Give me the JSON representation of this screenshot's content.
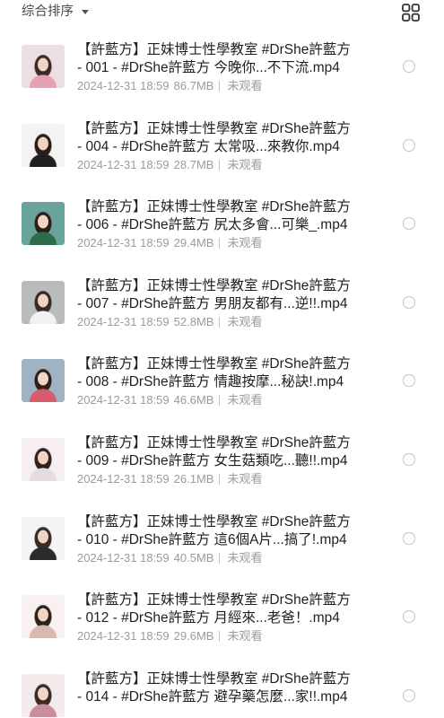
{
  "header": {
    "sort_label": "综合排序",
    "sort_icon": "caret-down-icon",
    "view_icon": "grid-view-icon"
  },
  "files": [
    {
      "title_lines": [
        "【許藍方】正妹博士性學教室 #DrShe許藍方",
        "- 001 - #DrShe許藍方 今晚你...不下流.mp4"
      ],
      "date": "2024-12-31 18:59",
      "size": "86.7MB",
      "status": "未观看",
      "thumb": {
        "bg": "#ecdfe4",
        "hair": "#3b2a25",
        "top": "#e6a0b3"
      }
    },
    {
      "title_lines": [
        "【許藍方】正妹博士性學教室 #DrShe許藍方",
        "- 004 - #DrShe許藍方 太常吸...來教你.mp4"
      ],
      "date": "2024-12-31 18:59",
      "size": "28.7MB",
      "status": "未观看",
      "thumb": {
        "bg": "#f3f3f1",
        "hair": "#2a1d18",
        "top": "#1f1f22"
      }
    },
    {
      "title_lines": [
        "【許藍方】正妹博士性學教室 #DrShe許藍方",
        "- 006 - #DrShe許藍方 尻太多會...可樂_.mp4"
      ],
      "date": "2024-12-31 18:59",
      "size": "29.4MB",
      "status": "未观看",
      "thumb": {
        "bg": "#6aa39a",
        "hair": "#2b1f1a",
        "top": "#2f6a4a"
      }
    },
    {
      "title_lines": [
        "【許藍方】正妹博士性學教室 #DrShe許藍方",
        "- 007 - #DrShe許藍方 男朋友都有...逆!!.mp4"
      ],
      "date": "2024-12-31 18:59",
      "size": "52.8MB",
      "status": "未观看",
      "thumb": {
        "bg": "#b9bcbf",
        "hair": "#3a2a22",
        "top": "#f1f1f1"
      }
    },
    {
      "title_lines": [
        "【許藍方】正妹博士性學教室 #DrShe許藍方",
        "- 008 - #DrShe許藍方 情趣按摩...秘訣!.mp4"
      ],
      "date": "2024-12-31 18:59",
      "size": "46.6MB",
      "status": "未观看",
      "thumb": {
        "bg": "#9fb3c4",
        "hair": "#2e211c",
        "top": "#d65c6b"
      }
    },
    {
      "title_lines": [
        "【許藍方】正妹博士性學教室 #DrShe許藍方",
        "- 009 - #DrShe許藍方 女生菇類吃...聽!!.mp4"
      ],
      "date": "2024-12-31 18:59",
      "size": "26.1MB",
      "status": "未观看",
      "thumb": {
        "bg": "#f6eef0",
        "hair": "#2f221d",
        "top": "#e4dde0"
      }
    },
    {
      "title_lines": [
        "【許藍方】正妹博士性學教室 #DrShe許藍方",
        "- 010 - #DrShe許藍方 這6個A片...搞了!.mp4"
      ],
      "date": "2024-12-31 18:59",
      "size": "40.5MB",
      "status": "未观看",
      "thumb": {
        "bg": "#f5f5f5",
        "hair": "#3a2b24",
        "top": "#2a2a2a"
      }
    },
    {
      "title_lines": [
        "【許藍方】正妹博士性學教室 #DrShe許藍方",
        "- 012 - #DrShe許藍方 月經來...老爸！.mp4"
      ],
      "date": "2024-12-31 18:59",
      "size": "29.6MB",
      "status": "未观看",
      "thumb": {
        "bg": "#f7f1ef",
        "hair": "#2d211c",
        "top": "#d9b8b0"
      }
    },
    {
      "title_lines": [
        "【許藍方】正妹博士性學教室 #DrShe許藍方",
        "- 014 - #DrShe許藍方 避孕藥怎麼...家!!.mp4"
      ],
      "thumb": {
        "bg": "#f2ecec",
        "hair": "#3a2823",
        "top": "#c98f9c"
      }
    }
  ]
}
